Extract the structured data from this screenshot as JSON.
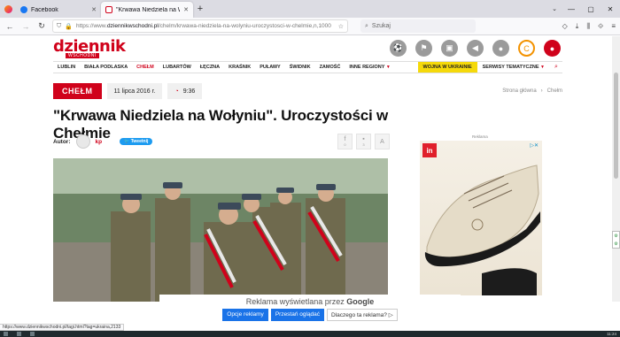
{
  "browser": {
    "tabs": [
      {
        "title": "Facebook",
        "active": false
      },
      {
        "title": "\"Krwawa Niedziela na Wołyniu\"",
        "active": true
      }
    ],
    "url_prefix": "https://www.",
    "url_domain": "dziennikwschodni.pl",
    "url_path": "/chelm/krwawa-niedziela-na-wolyniu-uroczystosci-w-chelmie,n,1000",
    "search_placeholder": "Szukaj",
    "status_url": "https://www.dziennikwschodni.pl/tagi.html?tag=ukraina,2133"
  },
  "site": {
    "logo": "dziennik",
    "logo_sub": "WSCHODNI",
    "header_icons": [
      "sport-icon",
      "sport2-icon",
      "jobs-icon",
      "megaphone-icon",
      "chat-icon",
      "logo-c-icon",
      "user-icon"
    ],
    "nav": [
      "LUBLIN",
      "BIAŁA PODLASKA",
      "CHEŁM",
      "LUBARTÓW",
      "ŁĘCZNA",
      "KRAŚNIK",
      "PUŁAWY",
      "ŚWIDNIK",
      "ZAMOŚĆ",
      "INNE REGIONY"
    ],
    "nav_active": "CHEŁM",
    "ukraine_label": "WOJNA W UKRAINIE",
    "serwisy_label": "SERWISY TEMATYCZNE"
  },
  "article": {
    "city": "CHEŁM",
    "date": "11 lipca 2016 r.",
    "time": "9:36",
    "breadcrumb_home": "Strona główna",
    "breadcrumb_sep": "›",
    "breadcrumb_city": "Chełm",
    "headline": "\"Krwawa Niedziela na Wołyniu\". Uroczystości w Chełmie",
    "author_label": "Autor:",
    "author": "kp",
    "tweet_label": "Tweetnij",
    "share_counts": [
      "0",
      "3"
    ],
    "font_resize": "A"
  },
  "ad": {
    "label": "Reklama",
    "brand": "in"
  },
  "google_banner": {
    "text_prefix": "Reklama wyświetlana przez",
    "brand": "Google",
    "btn_options": "Opcje reklamy",
    "btn_stop": "Przestań oglądać",
    "btn_why": "Dlaczego ta reklama? ▷"
  },
  "taskbar": {
    "clock": "11:24"
  }
}
